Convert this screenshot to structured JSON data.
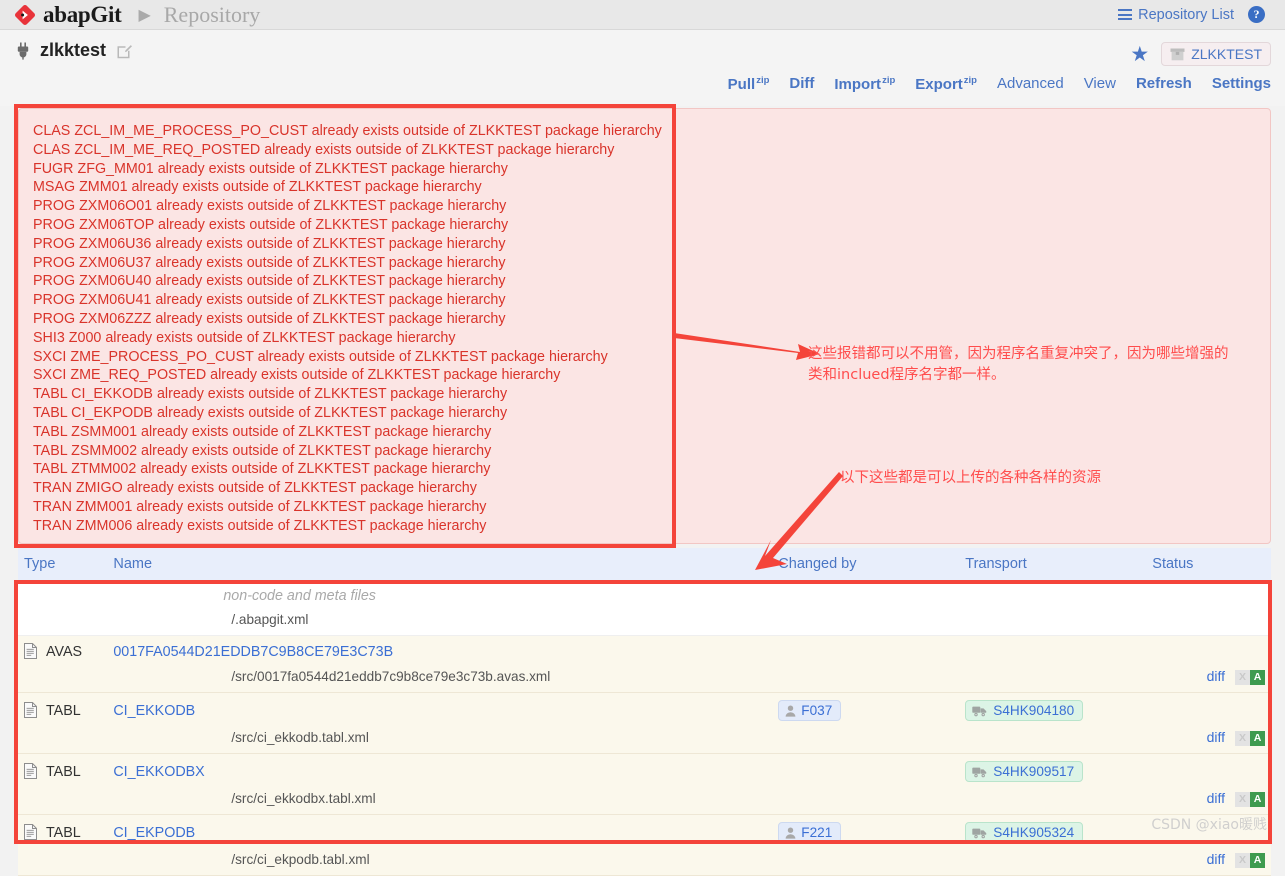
{
  "topbar": {
    "brand": "abapGit",
    "separator_icon": "play-triangle-icon",
    "page": "Repository",
    "repo_list_label": "Repository List",
    "repo_list_icon": "hamburger-icon",
    "help_icon": "help-question-icon",
    "help_label": "?"
  },
  "repo": {
    "icon": "plug-icon",
    "name": "zlkktest",
    "edit_icon": "edit-pencil-icon",
    "star_icon": "star-icon",
    "star_glyph": "★",
    "package_icon": "package-box-icon",
    "package": "ZLKKTEST"
  },
  "actions": [
    {
      "label": "Pull",
      "sup": "zip",
      "bold": true
    },
    {
      "label": "Diff",
      "sup": "",
      "bold": true
    },
    {
      "label": "Import",
      "sup": "zip",
      "bold": true
    },
    {
      "label": "Export",
      "sup": "zip",
      "bold": true
    },
    {
      "label": "Advanced",
      "sup": "",
      "bold": false
    },
    {
      "label": "View",
      "sup": "",
      "bold": false
    },
    {
      "label": "Refresh",
      "sup": "",
      "bold": true
    },
    {
      "label": "Settings",
      "sup": "",
      "bold": true
    }
  ],
  "errors": [
    "CLAS ZCL_IM_ME_PROCESS_PO_CUST already exists outside of ZLKKTEST package hierarchy",
    "CLAS ZCL_IM_ME_REQ_POSTED already exists outside of ZLKKTEST package hierarchy",
    "FUGR ZFG_MM01 already exists outside of ZLKKTEST package hierarchy",
    "MSAG ZMM01 already exists outside of ZLKKTEST package hierarchy",
    "PROG ZXM06O01 already exists outside of ZLKKTEST package hierarchy",
    "PROG ZXM06TOP already exists outside of ZLKKTEST package hierarchy",
    "PROG ZXM06U36 already exists outside of ZLKKTEST package hierarchy",
    "PROG ZXM06U37 already exists outside of ZLKKTEST package hierarchy",
    "PROG ZXM06U40 already exists outside of ZLKKTEST package hierarchy",
    "PROG ZXM06U41 already exists outside of ZLKKTEST package hierarchy",
    "PROG ZXM06ZZZ already exists outside of ZLKKTEST package hierarchy",
    "SHI3 Z000 already exists outside of ZLKKTEST package hierarchy",
    "SXCI ZME_PROCESS_PO_CUST already exists outside of ZLKKTEST package hierarchy",
    "SXCI ZME_REQ_POSTED already exists outside of ZLKKTEST package hierarchy",
    "TABL CI_EKKODB already exists outside of ZLKKTEST package hierarchy",
    "TABL CI_EKPODB already exists outside of ZLKKTEST package hierarchy",
    "TABL ZSMM001 already exists outside of ZLKKTEST package hierarchy",
    "TABL ZSMM002 already exists outside of ZLKKTEST package hierarchy",
    "TABL ZTMM002 already exists outside of ZLKKTEST package hierarchy",
    "TRAN ZMIGO already exists outside of ZLKKTEST package hierarchy",
    "TRAN ZMM001 already exists outside of ZLKKTEST package hierarchy",
    "TRAN ZMM006 already exists outside of ZLKKTEST package hierarchy"
  ],
  "annotations": {
    "note1_line1": "这些报错都可以不用管，因为程序名重复冲突了，因为哪些增强的",
    "note1_line2": "类和inclued程序名字都一样。",
    "note2": "以下这些都是可以上传的各种各样的资源",
    "arrow1_icon": "red-arrow-right-icon",
    "arrow2_icon": "red-arrow-downleft-icon",
    "accent_color": "#f4443a"
  },
  "table": {
    "columns": [
      "Type",
      "Name",
      "Changed by",
      "Transport",
      "Status"
    ],
    "rows": [
      {
        "kind": "group",
        "type": "",
        "name": "non-code and meta files",
        "path": "/.abapgit.xml",
        "changed_by": "",
        "transport": "",
        "diff": "",
        "status_x": "",
        "status_a": ""
      },
      {
        "kind": "file",
        "type": "AVAS",
        "name": "0017FA0544D21EDDB7C9B8CE79E3C73B",
        "path": "/src/0017fa0544d21eddb7c9b8ce79e3c73b.avas.xml",
        "changed_by": "",
        "transport": "",
        "diff": "diff",
        "status_x": "X",
        "status_a": "A"
      },
      {
        "kind": "file",
        "type": "TABL",
        "name": "CI_EKKODB",
        "path": "/src/ci_ekkodb.tabl.xml",
        "changed_by": "F037",
        "transport": "S4HK904180",
        "diff": "diff",
        "status_x": "X",
        "status_a": "A"
      },
      {
        "kind": "file",
        "type": "TABL",
        "name": "CI_EKKODBX",
        "path": "/src/ci_ekkodbx.tabl.xml",
        "changed_by": "",
        "transport": "S4HK909517",
        "diff": "diff",
        "status_x": "X",
        "status_a": "A"
      },
      {
        "kind": "file",
        "type": "TABL",
        "name": "CI_EKPODB",
        "path": "/src/ci_ekpodb.tabl.xml",
        "changed_by": "F221",
        "transport": "S4HK905324",
        "diff": "diff",
        "status_x": "X",
        "status_a": "A"
      }
    ]
  },
  "watermark": "CSDN @xiao暖贱"
}
